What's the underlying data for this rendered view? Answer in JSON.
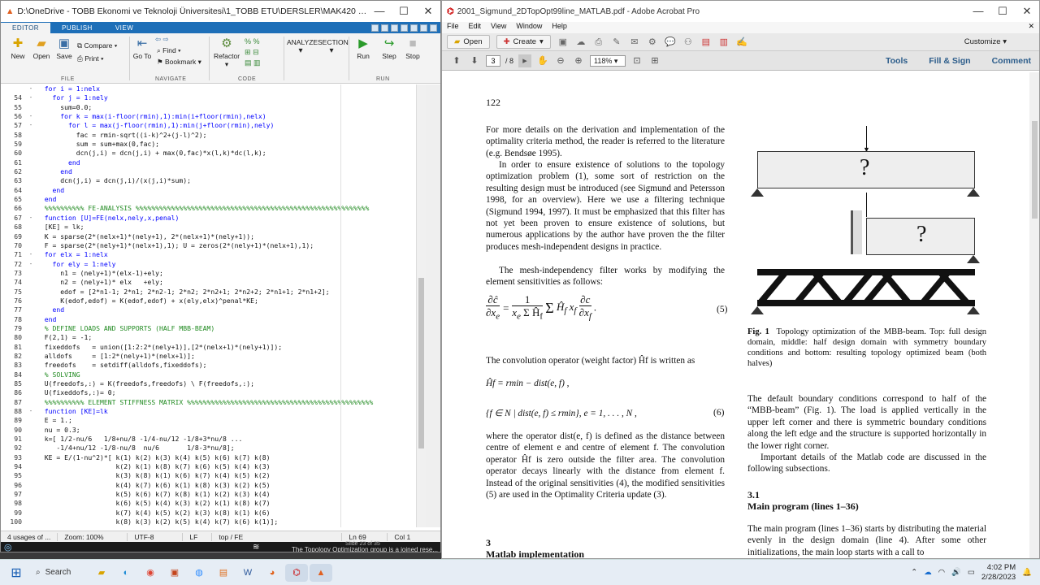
{
  "matlab": {
    "title": "D:\\OneDrive - TOBB Ekonomi ve Teknoloji Üniversitesi\\1_TOBB ETU\\DERSLER\\MAK420 - CAD\\MAK420_FOLDER\\Pape...",
    "tabs": [
      "EDITOR",
      "PUBLISH",
      "VIEW"
    ],
    "ribbon": {
      "new": "New",
      "open": "Open",
      "save": "Save",
      "compare": "Compare",
      "print": "Print",
      "goto": "Go To",
      "find": "Find",
      "bookmark": "Bookmark",
      "refactor": "Refactor",
      "analyze": "ANALYZE",
      "section": "SECTION",
      "run": "Run",
      "step": "Step",
      "stop": "Stop",
      "sections": [
        "FILE",
        "NAVIGATE",
        "CODE",
        "RUN"
      ]
    },
    "code_lines": [
      {
        "n": "",
        "fold": "-",
        "t": "  for i = 1:nelx",
        "c": "kw"
      },
      {
        "n": "54",
        "fold": "-",
        "t": "    for j = 1:nely",
        "c": "kw"
      },
      {
        "n": "55",
        "fold": "",
        "t": "      sum=0.0;",
        "c": ""
      },
      {
        "n": "56",
        "fold": "-",
        "t": "      for k = max(i-floor(rmin),1):min(i+floor(rmin),nelx)",
        "c": "kw"
      },
      {
        "n": "57",
        "fold": "-",
        "t": "        for l = max(j-floor(rmin),1):min(j+floor(rmin),nely)",
        "c": "kw"
      },
      {
        "n": "58",
        "fold": "",
        "t": "          fac = rmin-sqrt((i-k)^2+(j-l)^2);",
        "c": ""
      },
      {
        "n": "59",
        "fold": "",
        "t": "          sum = sum+max(0,fac);",
        "c": ""
      },
      {
        "n": "60",
        "fold": "",
        "t": "          dcn(j,i) = dcn(j,i) + max(0,fac)*x(l,k)*dc(l,k);",
        "c": ""
      },
      {
        "n": "61",
        "fold": "",
        "t": "        end",
        "c": "kw"
      },
      {
        "n": "62",
        "fold": "",
        "t": "      end",
        "c": "kw"
      },
      {
        "n": "63",
        "fold": "",
        "t": "      dcn(j,i) = dcn(j,i)/(x(j,i)*sum);",
        "c": ""
      },
      {
        "n": "64",
        "fold": "",
        "t": "    end",
        "c": "kw"
      },
      {
        "n": "65",
        "fold": "",
        "t": "  end",
        "c": "kw"
      },
      {
        "n": "66",
        "fold": "",
        "t": "  %%%%%%%%%% FE-ANALYSIS %%%%%%%%%%%%%%%%%%%%%%%%%%%%%%%%%%%%%%%%%%%%%%%%%%%%%%%%%%%",
        "c": "cm"
      },
      {
        "n": "67",
        "fold": "-",
        "t": "  function [U]=FE(nelx,nely,x,penal)",
        "c": "kw"
      },
      {
        "n": "68",
        "fold": "",
        "t": "  [KE] = lk;",
        "c": ""
      },
      {
        "n": "69",
        "fold": "",
        "t": "  K = sparse(2*(nelx+1)*(nely+1), 2*(nelx+1)*(nely+1));",
        "c": ""
      },
      {
        "n": "70",
        "fold": "",
        "t": "  F = sparse(2*(nely+1)*(nelx+1),1); U = zeros(2*(nely+1)*(nelx+1),1);",
        "c": ""
      },
      {
        "n": "71",
        "fold": "-",
        "t": "  for elx = 1:nelx",
        "c": "kw"
      },
      {
        "n": "72",
        "fold": "-",
        "t": "    for ely = 1:nely",
        "c": "kw"
      },
      {
        "n": "73",
        "fold": "",
        "t": "      n1 = (nely+1)*(elx-1)+ely;",
        "c": ""
      },
      {
        "n": "74",
        "fold": "",
        "t": "      n2 = (nely+1)* elx   +ely;",
        "c": ""
      },
      {
        "n": "75",
        "fold": "",
        "t": "      edof = [2*n1-1; 2*n1; 2*n2-1; 2*n2; 2*n2+1; 2*n2+2; 2*n1+1; 2*n1+2];",
        "c": ""
      },
      {
        "n": "76",
        "fold": "",
        "t": "      K(edof,edof) = K(edof,edof) + x(ely,elx)^penal*KE;",
        "c": ""
      },
      {
        "n": "77",
        "fold": "",
        "t": "    end",
        "c": "kw"
      },
      {
        "n": "78",
        "fold": "",
        "t": "  end",
        "c": "kw"
      },
      {
        "n": "79",
        "fold": "",
        "t": "  % DEFINE LOADS AND SUPPORTS (HALF MBB-BEAM)",
        "c": "cm"
      },
      {
        "n": "80",
        "fold": "",
        "t": "  F(2,1) = -1;",
        "c": ""
      },
      {
        "n": "81",
        "fold": "",
        "t": "  fixeddofs   = union([1:2:2*(nely+1)],[2*(nelx+1)*(nely+1)]);",
        "c": ""
      },
      {
        "n": "82",
        "fold": "",
        "t": "  alldofs     = [1:2*(nely+1)*(nelx+1)];",
        "c": ""
      },
      {
        "n": "83",
        "fold": "",
        "t": "  freedofs    = setdiff(alldofs,fixeddofs);",
        "c": ""
      },
      {
        "n": "84",
        "fold": "",
        "t": "  % SOLVING",
        "c": "cm"
      },
      {
        "n": "85",
        "fold": "",
        "t": "  U(freedofs,:) = K(freedofs,freedofs) \\ F(freedofs,:);",
        "c": ""
      },
      {
        "n": "86",
        "fold": "",
        "t": "  U(fixeddofs,:)= 0;",
        "c": ""
      },
      {
        "n": "87",
        "fold": "",
        "t": "  %%%%%%%%%% ELEMENT STIFFNESS MATRIX %%%%%%%%%%%%%%%%%%%%%%%%%%%%%%%%%%%%%%%%%%%%%%%",
        "c": "cm"
      },
      {
        "n": "88",
        "fold": "-",
        "t": "  function [KE]=lk",
        "c": "kw"
      },
      {
        "n": "89",
        "fold": "",
        "t": "  E = 1.;",
        "c": ""
      },
      {
        "n": "90",
        "fold": "",
        "t": "  nu = 0.3;",
        "c": ""
      },
      {
        "n": "91",
        "fold": "",
        "t": "  k=[ 1/2-nu/6   1/8+nu/8 -1/4-nu/12 -1/8+3*nu/8 ...",
        "c": ""
      },
      {
        "n": "92",
        "fold": "",
        "t": "     -1/4+nu/12 -1/8-nu/8  nu/6       1/8-3*nu/8];",
        "c": ""
      },
      {
        "n": "93",
        "fold": "",
        "t": "  KE = E/(1-nu^2)*[ k(1) k(2) k(3) k(4) k(5) k(6) k(7) k(8)",
        "c": ""
      },
      {
        "n": "94",
        "fold": "",
        "t": "                    k(2) k(1) k(8) k(7) k(6) k(5) k(4) k(3)",
        "c": ""
      },
      {
        "n": "95",
        "fold": "",
        "t": "                    k(3) k(8) k(1) k(6) k(7) k(4) k(5) k(2)",
        "c": ""
      },
      {
        "n": "96",
        "fold": "",
        "t": "                    k(4) k(7) k(6) k(1) k(8) k(3) k(2) k(5)",
        "c": ""
      },
      {
        "n": "97",
        "fold": "",
        "t": "                    k(5) k(6) k(7) k(8) k(1) k(2) k(3) k(4)",
        "c": ""
      },
      {
        "n": "98",
        "fold": "",
        "t": "                    k(6) k(5) k(4) k(3) k(2) k(1) k(8) k(7)",
        "c": ""
      },
      {
        "n": "99",
        "fold": "",
        "t": "                    k(7) k(4) k(5) k(2) k(3) k(8) k(1) k(6)",
        "c": ""
      },
      {
        "n": "100",
        "fold": "",
        "t": "                    k(8) k(3) k(2) k(5) k(4) k(7) k(6) k(1)];",
        "c": ""
      },
      {
        "n": "101",
        "fold": "",
        "t": "  %",
        "c": "cm"
      }
    ],
    "status": {
      "usages": "4 usages of ...",
      "zoom": "Zoom: 100%",
      "encoding": "UTF-8",
      "eol": "LF",
      "scope": "top / FE",
      "ln": "Ln  69",
      "col": "Col  1"
    },
    "bottom_text": "The Topology Optimization group is a joined rese...",
    "slide": "Slide 23 of 35"
  },
  "acrobat": {
    "title": "2001_Sigmund_2DTopOpt99line_MATLAB.pdf - Adobe Acrobat Pro",
    "menu": [
      "File",
      "Edit",
      "View",
      "Window",
      "Help"
    ],
    "toolbar": {
      "open": "Open",
      "create": "Create",
      "customize": "Customize"
    },
    "page_current": "3",
    "page_total": "/ 8",
    "zoom": "118%",
    "panels": [
      "Tools",
      "Fill & Sign",
      "Comment"
    ],
    "doc": {
      "page_number": "122",
      "p1": "For more details on the derivation and implementation of the optimality criteria method, the reader is referred to the literature (e.g. Bendsøe 1995).",
      "p2": "In order to ensure existence of solutions to the topology optimization problem (1), some sort of restriction on the resulting design must be introduced (see Sigmund and Petersson 1998, for an overview). Here we use a filtering technique (Sigmund 1994, 1997). It must be emphasized that this filter has not yet been proven to ensure existence of solutions, but numerous applications by the author have proven the the filter produces mesh-independent designs in practice.",
      "p3": "The mesh-independency filter works by modifying the element sensitivities as follows:",
      "eq5_num": "(5)",
      "p4": "The convolution operator (weight factor) Ĥf is written as",
      "eq_h": "Ĥf = rmin − dist(e, f) ,",
      "eq6": "{f ∈ N | dist(e, f) ≤ rmin},    e = 1, . . . , N ,",
      "eq6_num": "(6)",
      "p5": "where the operator dist(e, f) is defined as the distance between centre of element e and centre of element f. The convolution operator Ĥf is zero outside the filter area. The convolution operator decays linearly with the distance from element f. Instead of the original sensitivities (4), the modified sensitivities (5) are used in the Optimality Criteria update (3).",
      "sec3_num": "3",
      "sec3_title": "Matlab implementation",
      "fig_caption_label": "Fig. 1",
      "fig_caption": "Topology optimization of the MBB-beam. Top: full design domain, middle: half design domain with symmetry boundary conditions and bottom: resulting topology optimized beam (both halves)",
      "fig_q": "?",
      "p6": "The default boundary conditions correspond to half of the “MBB-beam” (Fig. 1). The load is applied vertically in the upper left corner and there is symmetric boundary conditions along the left edge and the structure is supported horizontally in the lower right corner.",
      "p7": "Important details of the Matlab code are discussed in the following subsections.",
      "sec31_num": "3.1",
      "sec31_title": "Main program (lines 1–36)",
      "p8": "The main program (lines 1–36) starts by distributing the material evenly in the design domain (line 4). After some other initializations, the main loop starts with a call to"
    }
  },
  "taskbar": {
    "search": "Search",
    "time": "4:02 PM",
    "date": "2/28/2023"
  },
  "colors": {
    "matlab_blue": "#1e6fb8",
    "code_keyword": "#0000ff",
    "code_comment": "#228b22"
  }
}
